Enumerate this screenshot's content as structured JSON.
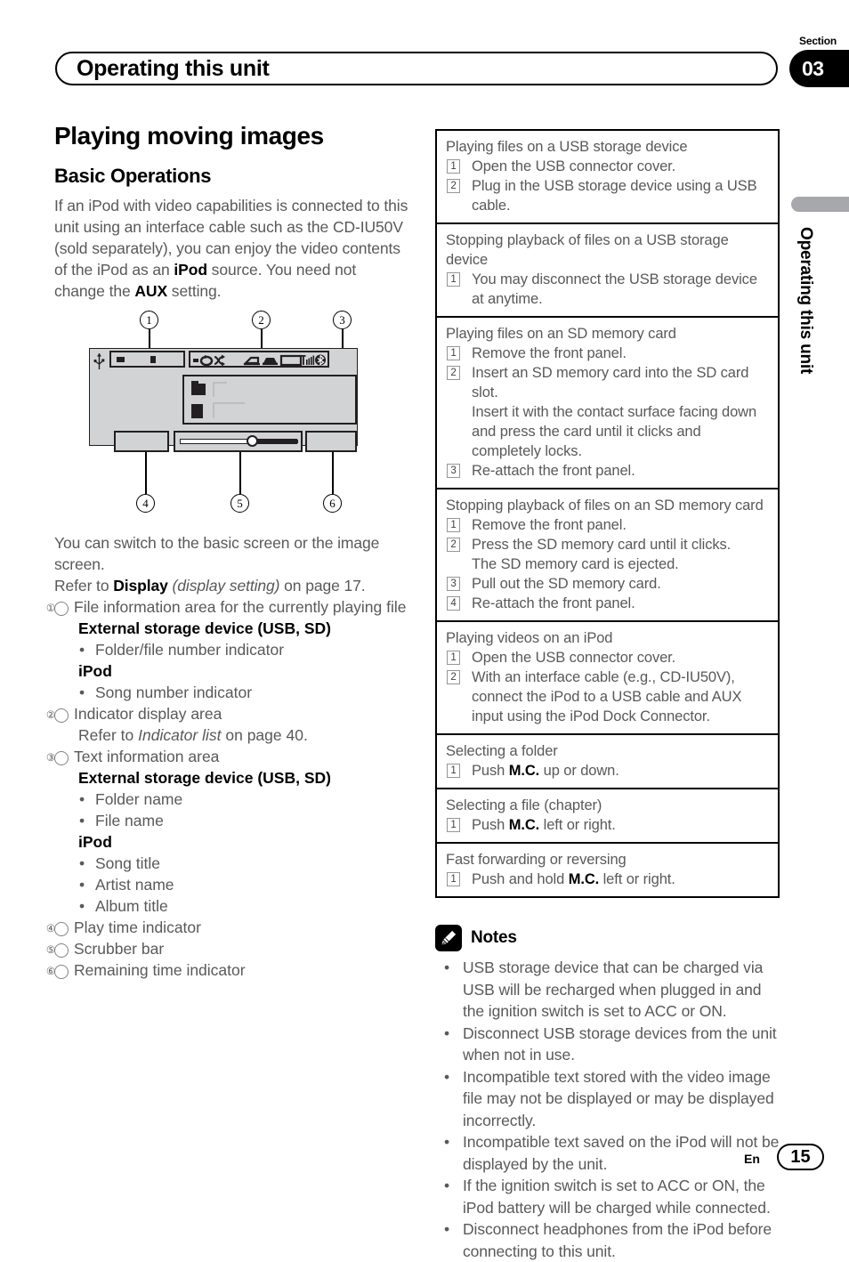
{
  "header": {
    "title": "Operating this unit",
    "section_label": "Section",
    "section_number": "03"
  },
  "side_tab": {
    "text": "Operating this unit"
  },
  "left": {
    "h1": "Playing moving images",
    "h2": "Basic Operations",
    "intro_pre": "If an iPod with video capabilities is connected to this unit using an interface cable such as the CD-IU50V (sold separately), you can enjoy the video contents of the iPod as an ",
    "intro_bold1": "iPod",
    "intro_mid": " source. You need not change the ",
    "intro_bold2": "AUX",
    "intro_post": " setting.",
    "after_diagram_1": "You can switch to the basic screen or the image screen.",
    "after_diagram_2_pre": "Refer to ",
    "after_diagram_2_bold": "Display",
    "after_diagram_2_ital": " (display setting)",
    "after_diagram_2_post": " on page 17.",
    "items": [
      {
        "num": "①",
        "text": "File information area for the currently playing file",
        "sub_heading_1": "External storage device (USB, SD)",
        "bullets_1": [
          "Folder/file number indicator"
        ],
        "sub_heading_2": "iPod",
        "bullets_2": [
          "Song number indicator"
        ]
      },
      {
        "num": "②",
        "text": "Indicator display area",
        "note_pre": "Refer to ",
        "note_ital": "Indicator list",
        "note_post": " on page 40."
      },
      {
        "num": "③",
        "text": "Text information area",
        "sub_heading_1": "External storage device (USB, SD)",
        "bullets_1": [
          "Folder name",
          "File name"
        ],
        "sub_heading_2": "iPod",
        "bullets_2": [
          "Song title",
          "Artist name",
          "Album title"
        ]
      },
      {
        "num": "④",
        "text": "Play time indicator"
      },
      {
        "num": "⑤",
        "text": "Scrubber bar"
      },
      {
        "num": "⑥",
        "text": "Remaining time indicator"
      }
    ],
    "diagram": {
      "callouts": [
        "1",
        "2",
        "3",
        "4",
        "5",
        "6"
      ],
      "icons": [
        "usb-icon",
        "folder-icon",
        "file-icon",
        "repeat-icon",
        "shuffle-icon",
        "sound-retriever-icon",
        "car-icon",
        "display-icon",
        "signal-icon",
        "bluetooth-icon"
      ]
    }
  },
  "operations": [
    {
      "title": "Playing files on a USB storage device",
      "steps": [
        {
          "n": "1",
          "text": "Open the USB connector cover."
        },
        {
          "n": "2",
          "text": "Plug in the USB storage device using a USB cable."
        }
      ]
    },
    {
      "title": "Stopping playback of files on a USB storage device",
      "steps": [
        {
          "n": "1",
          "text": "You may disconnect the USB storage device at anytime."
        }
      ]
    },
    {
      "title": "Playing files on an SD memory card",
      "steps": [
        {
          "n": "1",
          "text": "Remove the front panel."
        },
        {
          "n": "2",
          "text": "Insert an SD memory card into the SD card slot.",
          "cont": "Insert it with the contact surface facing down and press the card until it clicks and completely locks."
        },
        {
          "n": "3",
          "text": "Re-attach the front panel."
        }
      ]
    },
    {
      "title": "Stopping playback of files on an SD memory card",
      "steps": [
        {
          "n": "1",
          "text": "Remove the front panel."
        },
        {
          "n": "2",
          "text": "Press the SD memory card until it clicks.",
          "cont": "The SD memory card is ejected."
        },
        {
          "n": "3",
          "text": "Pull out the SD memory card."
        },
        {
          "n": "4",
          "text": "Re-attach the front panel."
        }
      ]
    },
    {
      "title": "Playing videos on an iPod",
      "steps": [
        {
          "n": "1",
          "text": "Open the USB connector cover."
        },
        {
          "n": "2",
          "text": "With an interface cable (e.g., CD-IU50V), connect the iPod to a USB cable and AUX input using the iPod Dock Connector."
        }
      ]
    },
    {
      "title": "Selecting a folder",
      "steps": [
        {
          "n": "1",
          "pre": "Push ",
          "bold": "M.C.",
          "post": " up or down."
        }
      ]
    },
    {
      "title": "Selecting a file (chapter)",
      "steps": [
        {
          "n": "1",
          "pre": "Push ",
          "bold": "M.C.",
          "post": " left or right."
        }
      ]
    },
    {
      "title": "Fast forwarding or reversing",
      "steps": [
        {
          "n": "1",
          "pre": "Push and hold ",
          "bold": "M.C.",
          "post": " left or right."
        }
      ]
    }
  ],
  "notes": {
    "title": "Notes",
    "icon": "pencil-icon",
    "items": [
      "USB storage device that can be charged via USB will be recharged when plugged in and the ignition switch is set to ACC or ON.",
      "Disconnect USB storage devices from the unit when not in use.",
      "Incompatible text stored with the video image file may not be displayed or may be displayed incorrectly.",
      "Incompatible text saved on the iPod will not be displayed by the unit.",
      "If the ignition switch is set to ACC or ON, the iPod battery will be charged while connected.",
      "Disconnect headphones from the iPod before connecting to this unit."
    ]
  },
  "footer": {
    "language": "En",
    "page_number": "15"
  },
  "colors": {
    "text": "#58595b",
    "heading": "#000000",
    "side_tab": "#a6a8ab",
    "screen_fill": "#d1d3d4"
  }
}
